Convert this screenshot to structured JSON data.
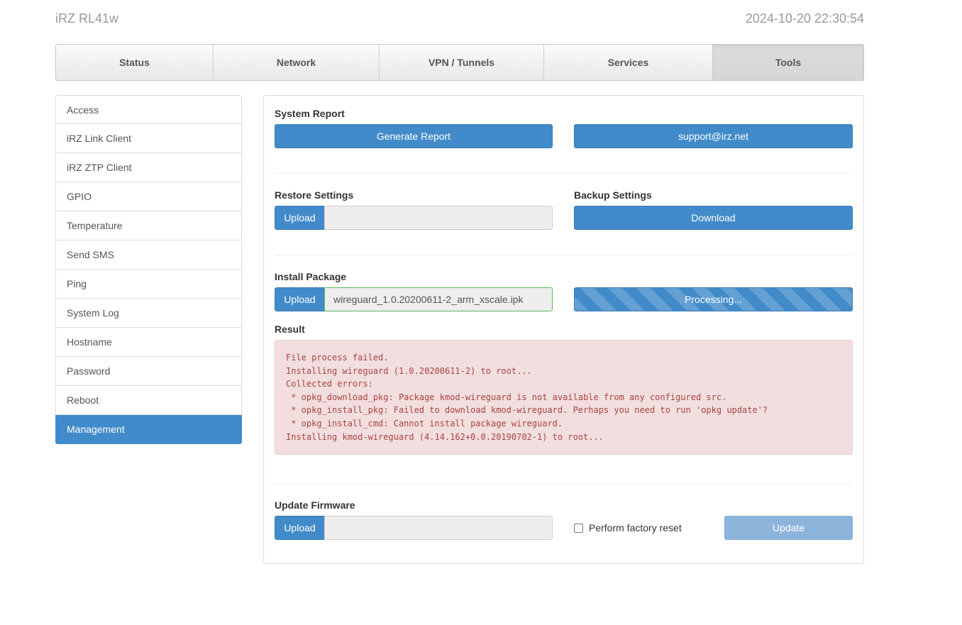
{
  "header": {
    "brand": "iRZ RL41w",
    "datetime": "2024-10-20 22:30:54"
  },
  "topnav": {
    "tabs": [
      {
        "label": "Status"
      },
      {
        "label": "Network"
      },
      {
        "label": "VPN / Tunnels"
      },
      {
        "label": "Services"
      },
      {
        "label": "Tools",
        "active": true
      }
    ]
  },
  "sidebar": {
    "items": [
      {
        "label": "Access"
      },
      {
        "label": "iRZ Link Client"
      },
      {
        "label": "iRZ ZTP Client"
      },
      {
        "label": "GPIO"
      },
      {
        "label": "Temperature"
      },
      {
        "label": "Send SMS"
      },
      {
        "label": "Ping"
      },
      {
        "label": "System Log"
      },
      {
        "label": "Hostname"
      },
      {
        "label": "Password"
      },
      {
        "label": "Reboot"
      },
      {
        "label": "Management",
        "active": true
      }
    ]
  },
  "system_report": {
    "title": "System Report",
    "generate_label": "Generate Report",
    "support_label": "support@irz.net"
  },
  "restore": {
    "title": "Restore Settings",
    "upload_label": "Upload",
    "filename": ""
  },
  "backup": {
    "title": "Backup Settings",
    "download_label": "Download"
  },
  "install_package": {
    "title": "Install Package",
    "upload_label": "Upload",
    "filename": "wireguard_1.0.20200611-2_arm_xscale.ipk",
    "progress_label": "Processing..."
  },
  "result": {
    "title": "Result",
    "lines": [
      "File process failed.",
      "Installing wireguard (1.0.20200611-2) to root...",
      "Collected errors:",
      " * opkg_download_pkg: Package kmod-wireguard is not available from any configured src.",
      " * opkg_install_pkg: Failed to download kmod-wireguard. Perhaps you need to run 'opkg update'?",
      " * opkg_install_cmd: Cannot install package wireguard.",
      "Installing kmod-wireguard (4.14.162+0.0.20190702-1) to root..."
    ]
  },
  "firmware": {
    "title": "Update Firmware",
    "upload_label": "Upload",
    "filename": "",
    "factory_reset_label": "Perform factory reset",
    "factory_reset_checked": false,
    "update_label": "Update"
  },
  "colors": {
    "primary": "#428bca",
    "error_bg": "#f2dede",
    "error_text": "#a94442",
    "active_tab": "#d6d6d6"
  }
}
